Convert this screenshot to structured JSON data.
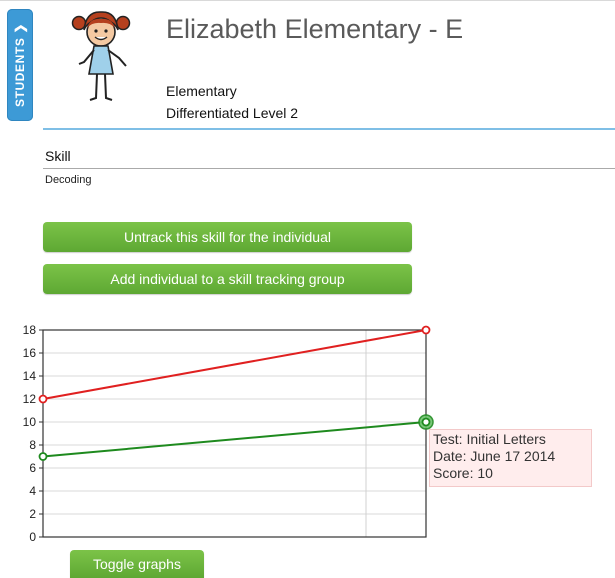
{
  "sidebar": {
    "students_tab_label": "STUDENTS ❯",
    "tab_color": "#3d9ad6"
  },
  "student": {
    "name": "Elizabeth Elementary - E",
    "school_type": "Elementary",
    "level": "Differentiated Level 2",
    "avatar_icon": "girl-avatar-icon"
  },
  "skill": {
    "heading": "Skill",
    "value": "Decoding"
  },
  "buttons": {
    "untrack": "Untrack this skill for the individual",
    "add_group": "Add individual to a skill tracking group",
    "toggle_graphs": "Toggle graphs",
    "color": "#6ab53c"
  },
  "chart_data": {
    "type": "line",
    "title": "",
    "xlabel": "",
    "ylabel": "",
    "ylim": [
      0,
      18
    ],
    "yticks": [
      0,
      2,
      4,
      6,
      8,
      10,
      12,
      14,
      16,
      18
    ],
    "grid": true,
    "series": [
      {
        "color": "#e02020",
        "values": [
          12,
          18
        ]
      },
      {
        "color": "#1e8a1e",
        "values": [
          7,
          10
        ]
      }
    ]
  },
  "tooltip": {
    "test": "Test: Initial Letters",
    "date": "Date: June 17 2014",
    "score": "Score: 10"
  }
}
